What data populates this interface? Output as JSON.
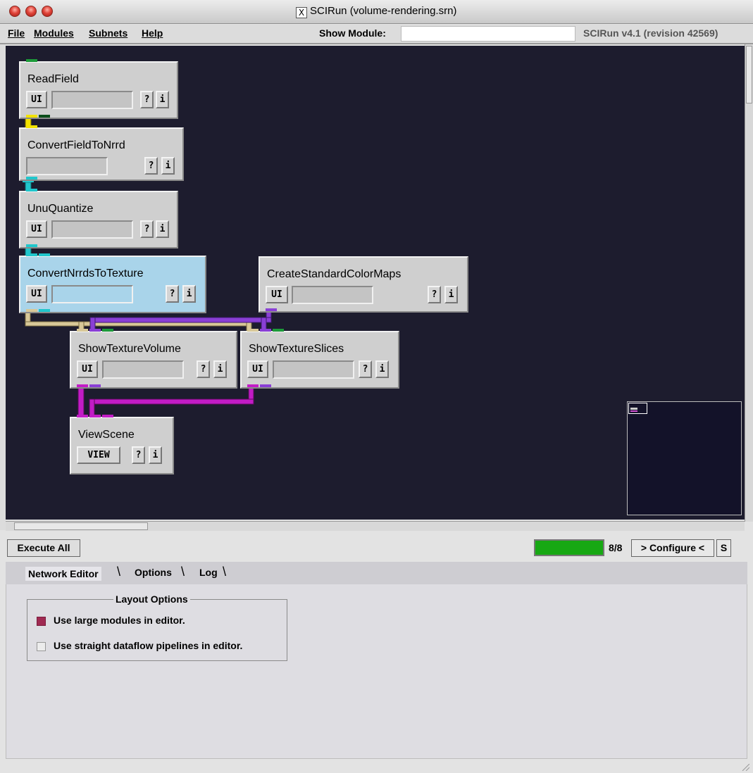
{
  "window": {
    "title": "SCIRun (volume-rendering.srn)"
  },
  "menubar": {
    "items": [
      {
        "label": "File"
      },
      {
        "label": "Modules"
      },
      {
        "label": "Subnets"
      },
      {
        "label": "Help"
      }
    ],
    "show_module_label": "Show Module:",
    "show_module_value": "",
    "version": "SCIRun v4.1 (revision 42569)"
  },
  "modules": [
    {
      "name": "ReadField",
      "buttons": [
        "UI",
        "?",
        "i"
      ]
    },
    {
      "name": "ConvertFieldToNrrd",
      "buttons": [
        "?",
        "i"
      ]
    },
    {
      "name": "UnuQuantize",
      "buttons": [
        "UI",
        "?",
        "i"
      ]
    },
    {
      "name": "ConvertNrrdsToTexture",
      "buttons": [
        "UI",
        "?",
        "i"
      ],
      "selected": true
    },
    {
      "name": "CreateStandardColorMaps",
      "buttons": [
        "UI",
        "?",
        "i"
      ]
    },
    {
      "name": "ShowTextureVolume",
      "buttons": [
        "UI",
        "?",
        "i"
      ]
    },
    {
      "name": "ShowTextureSlices",
      "buttons": [
        "UI",
        "?",
        "i"
      ]
    },
    {
      "name": "ViewScene",
      "buttons": [
        "VIEW",
        "?",
        "i"
      ]
    }
  ],
  "colors": {
    "canvas_bg": "#1d1c2e",
    "pipe_field": "#f2e200",
    "pipe_nrrd": "#20c6cc",
    "pipe_texture": "#d8c898",
    "pipe_colormap": "#8a3fd6",
    "pipe_geometry": "#c21cc6",
    "progress": "#17a813",
    "checkbox_on": "#a02a52"
  },
  "controls": {
    "execute_all": "Execute All",
    "progress_text": "8/8",
    "progress_fraction": 1.0,
    "configure": "> Configure <",
    "s_button": "S"
  },
  "tabs": [
    {
      "label": "Network Editor",
      "active": true
    },
    {
      "label": "Options",
      "active": false
    },
    {
      "label": "Log",
      "active": false
    }
  ],
  "layout_options": {
    "title": "Layout Options",
    "options": [
      {
        "label": "Use large modules in editor.",
        "checked": true
      },
      {
        "label": "Use straight dataflow pipelines in editor.",
        "checked": false
      }
    ]
  }
}
